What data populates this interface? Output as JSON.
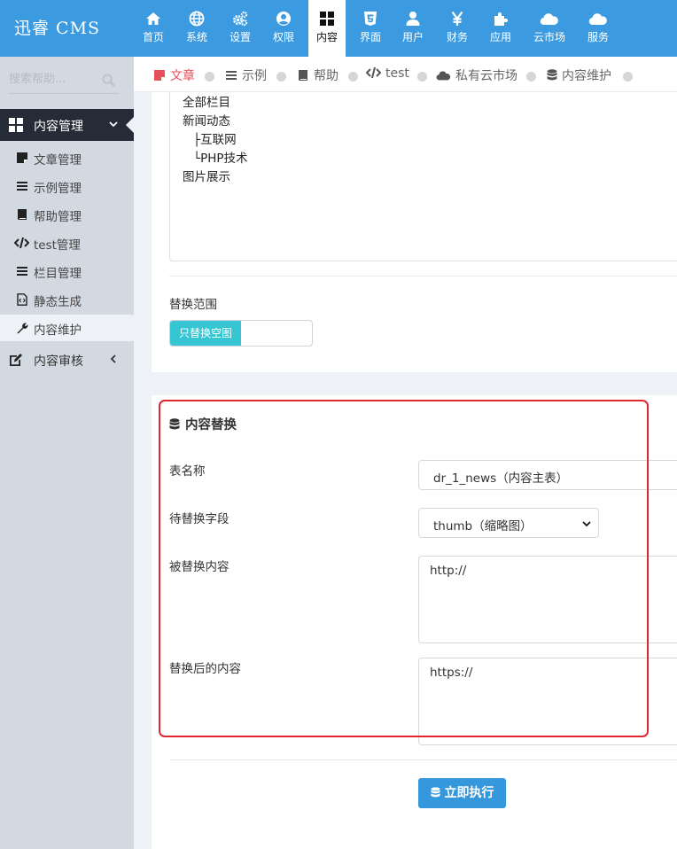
{
  "app": {
    "logo": "迅睿 CMS"
  },
  "topnav": [
    {
      "label": "首页",
      "icon": "home-icon"
    },
    {
      "label": "系统",
      "icon": "globe-icon"
    },
    {
      "label": "设置",
      "icon": "cogs-icon"
    },
    {
      "label": "权限",
      "icon": "user-circle-icon"
    },
    {
      "label": "内容",
      "icon": "th-large-icon",
      "active": true
    },
    {
      "label": "界面",
      "icon": "html5-icon"
    },
    {
      "label": "用户",
      "icon": "user-icon"
    },
    {
      "label": "财务",
      "icon": "yen-icon"
    },
    {
      "label": "应用",
      "icon": "puzzle-icon"
    },
    {
      "label": "云市场",
      "icon": "cloud-icon"
    },
    {
      "label": "服务",
      "icon": "cloud-icon"
    }
  ],
  "sidebar": {
    "search_placeholder": "搜索帮助...",
    "group_open": {
      "label": "内容管理",
      "icon": "th-large-icon"
    },
    "items": [
      {
        "label": "文章管理",
        "icon": "sticky-note-icon"
      },
      {
        "label": "示例管理",
        "icon": "list-icon"
      },
      {
        "label": "帮助管理",
        "icon": "book-icon"
      },
      {
        "label": "test管理",
        "icon": "code-icon"
      },
      {
        "label": "栏目管理",
        "icon": "list-icon"
      },
      {
        "label": "静态生成",
        "icon": "file-code-icon"
      },
      {
        "label": "内容维护",
        "icon": "wrench-icon",
        "active": true
      }
    ],
    "group_closed": {
      "label": "内容审核",
      "icon": "edit-icon"
    }
  },
  "tabs": [
    {
      "label": "文章",
      "icon": "sticky-note-icon",
      "active": true
    },
    {
      "label": "示例",
      "icon": "list-icon"
    },
    {
      "label": "帮助",
      "icon": "book-icon"
    },
    {
      "label": "test",
      "icon": "code-icon"
    },
    {
      "label": "私有云市场",
      "icon": "cloud-icon"
    },
    {
      "label": "内容维护",
      "icon": "database-icon"
    }
  ],
  "category_tree": [
    "全部栏目",
    "新闻动态",
    "├互联网",
    "└PHP技术",
    "图片展示"
  ],
  "scope": {
    "label": "替换范围",
    "toggle_on": "只替换空图"
  },
  "replace_form": {
    "title": "内容替换",
    "table_label": "表名称",
    "table_value": "dr_1_news（内容主表）",
    "field_label": "待替换字段",
    "field_value": "thumb（缩略图）",
    "find_label": "被替换内容",
    "find_value": "http://",
    "replace_label": "替换后的内容",
    "replace_value": "https://",
    "run_button": "立即执行"
  },
  "colors": {
    "topbar": "#3c9be0",
    "sidebar": "#d3d9e0",
    "sidebar_active_group": "#252c37",
    "active_tab": "#e7505a",
    "toggle_on": "#36c6d3",
    "button": "#3598dc",
    "highlight": "#e0262e"
  }
}
